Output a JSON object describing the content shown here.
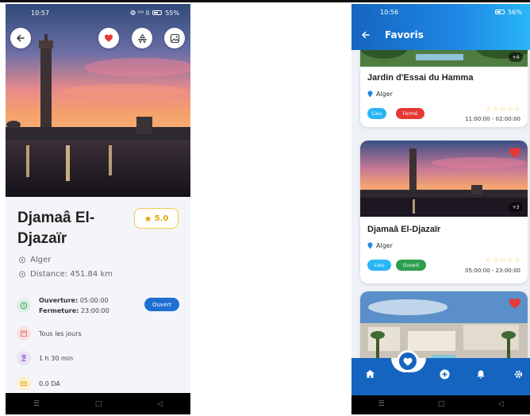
{
  "left": {
    "status": {
      "time": "10:57",
      "battery": "55%",
      "signal": "❂ ᴴᴰ ll"
    },
    "place": {
      "name": "Djamaâ El-Djazaïr",
      "rating": "5.0",
      "city": "Alger",
      "distance": "Distance: 451.84 km"
    },
    "hours": {
      "opening_label": "Ouverture:",
      "opening_time": "05:00:00",
      "closing_label": "Fermeture:",
      "closing_time": "23:00:00",
      "status": "Ouvert"
    },
    "days": "Tous les jours",
    "duration": "1 h 30 min",
    "price": "0.0 DA",
    "icons": [
      "back-arrow-icon",
      "heart-icon",
      "recycle-icon",
      "image-icon",
      "pin-icon",
      "clock-icon",
      "calendar-icon",
      "hourglass-icon",
      "ticket-icon",
      "star-icon"
    ]
  },
  "right": {
    "status": {
      "time": "10:56",
      "battery": "56%"
    },
    "header": {
      "title": "Favoris"
    },
    "cards": [
      {
        "name": "Jardin d'Essai du Hamma",
        "city": "Alger",
        "type_tag": "Lieu",
        "status_tag": "Fermé",
        "hours": "11:00:00 - 02:00:00",
        "more_photos": "+4"
      },
      {
        "name": "Djamaâ El-Djazaïr",
        "city": "Alger",
        "type_tag": "Lieu",
        "status_tag": "Ouvert",
        "hours": "05:00:00 - 23:00:00",
        "more_photos": "+3"
      },
      {
        "name": "",
        "city": "",
        "type_tag": "",
        "status_tag": "",
        "hours": "",
        "more_photos": ""
      }
    ],
    "nav": [
      "home-icon",
      "favorites-icon",
      "add-icon",
      "bell-icon",
      "settings-icon"
    ]
  },
  "colors": {
    "accent": "#1565c0",
    "open": "#2e9e4f",
    "closed": "#e53935",
    "tag_blue": "#29b6f6",
    "star": "#f2c94c",
    "heart": "#e53935"
  }
}
